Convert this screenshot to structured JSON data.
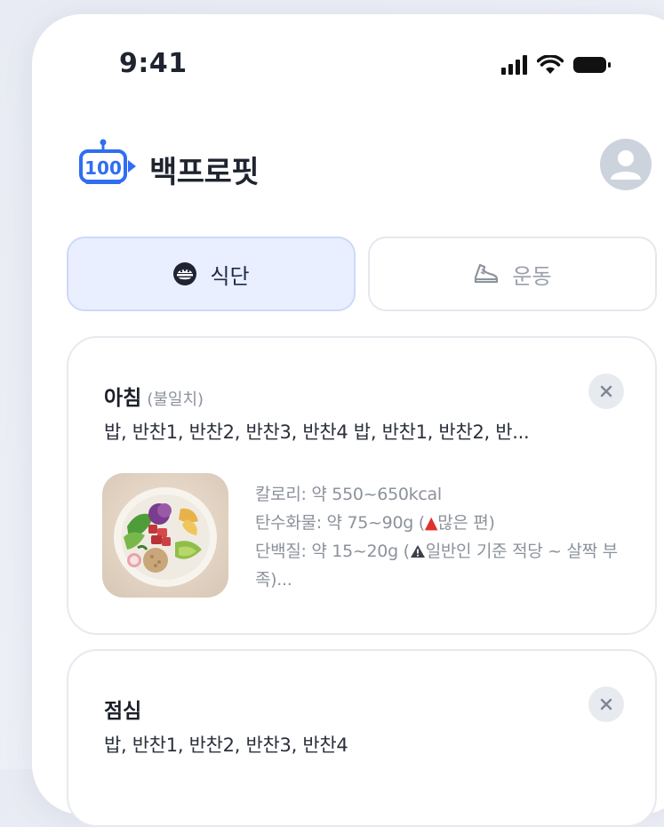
{
  "status_bar": {
    "time": "9:41"
  },
  "header": {
    "app_name": "백프로핏",
    "logo_text": "100"
  },
  "tabs": [
    {
      "label": "식단",
      "icon": "meal-icon",
      "active": true
    },
    {
      "label": "운동",
      "icon": "shoe-icon",
      "active": false
    }
  ],
  "meals": [
    {
      "title": "아침",
      "tag": "(불일치)",
      "items": "밥, 반찬1, 반찬2, 반찬3, 반찬4 밥, 반찬1, 반찬2, 반...",
      "nutrition": {
        "calories": "칼로리: 약 550~650kcal",
        "carbs_prefix": "탄수화물: 약 75~90g (",
        "carbs_badge": "▲",
        "carbs_suffix": "많은 편)",
        "protein_prefix": "단백질: 약 15~20g (",
        "protein_suffix": "일반인 기준 적당 ~ 살짝 부족)..."
      }
    },
    {
      "title": "점심",
      "tag": "",
      "items": "밥, 반찬1, 반찬2, 반찬3, 반찬4"
    }
  ],
  "colors": {
    "accent_bg": "#e9efff",
    "accent_border": "#cdd9fb",
    "brand_blue": "#2f6ef0",
    "warning_red": "#e0312e"
  }
}
